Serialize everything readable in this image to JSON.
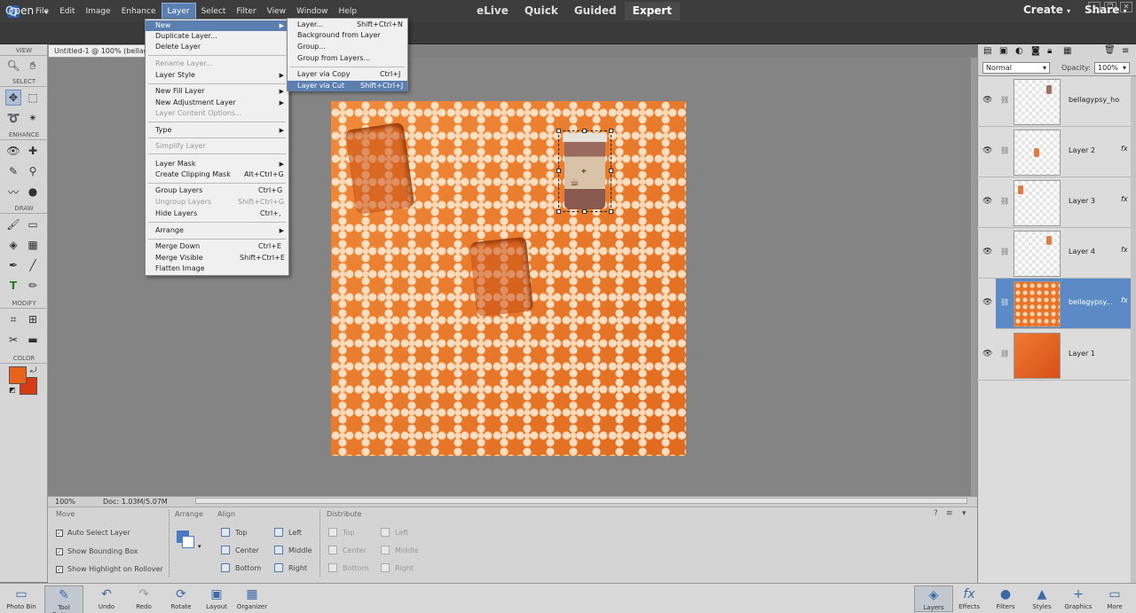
{
  "menubar": {
    "items": [
      "File",
      "Edit",
      "Image",
      "Enhance",
      "Layer",
      "Select",
      "Filter",
      "View",
      "Window",
      "Help"
    ],
    "active": "Layer"
  },
  "modebar": {
    "open_label": "Open",
    "modes": [
      "eLive",
      "Quick",
      "Guided",
      "Expert"
    ],
    "selected_mode": "Expert",
    "create_label": "Create",
    "share_label": "Share"
  },
  "document": {
    "tab_title": "Untitled-1 @ 100% (bellag",
    "zoom": "100%",
    "doc_size": "Doc: 1.03M/5.07M"
  },
  "toolbox": {
    "sections": [
      "VIEW",
      "SELECT",
      "ENHANCE",
      "DRAW",
      "MODIFY",
      "COLOR"
    ],
    "foreground_color": "#e8621a",
    "background_color": "#d83a14"
  },
  "layer_menu": {
    "items": [
      {
        "label": "New",
        "shortcut": "",
        "submenu": true,
        "highlighted": true
      },
      {
        "label": "Duplicate Layer...",
        "shortcut": ""
      },
      {
        "label": "Delete Layer",
        "shortcut": ""
      },
      {
        "label": "Rename Layer...",
        "shortcut": "",
        "disabled": true
      },
      {
        "label": "Layer Style",
        "shortcut": "",
        "submenu": true
      },
      {
        "label": "New Fill Layer",
        "shortcut": "",
        "submenu": true
      },
      {
        "label": "New Adjustment Layer",
        "shortcut": "",
        "submenu": true
      },
      {
        "label": "Layer Content Options...",
        "shortcut": "",
        "disabled": true
      },
      {
        "label": "Type",
        "shortcut": "",
        "submenu": true
      },
      {
        "label": "Simplify Layer",
        "shortcut": "",
        "disabled": true
      },
      {
        "label": "Layer Mask",
        "shortcut": "",
        "submenu": true
      },
      {
        "label": "Create Clipping Mask",
        "shortcut": "Alt+Ctrl+G"
      },
      {
        "label": "Group Layers",
        "shortcut": "Ctrl+G"
      },
      {
        "label": "Ungroup Layers",
        "shortcut": "Shift+Ctrl+G",
        "disabled": true
      },
      {
        "label": "Hide Layers",
        "shortcut": "Ctrl+,"
      },
      {
        "label": "Arrange",
        "shortcut": "",
        "submenu": true
      },
      {
        "label": "Merge Down",
        "shortcut": "Ctrl+E"
      },
      {
        "label": "Merge Visible",
        "shortcut": "Shift+Ctrl+E"
      },
      {
        "label": "Flatten Image",
        "shortcut": ""
      }
    ]
  },
  "new_submenu": {
    "items": [
      {
        "label": "Layer...",
        "shortcut": "Shift+Ctrl+N"
      },
      {
        "label": "Background from Layer",
        "shortcut": ""
      },
      {
        "label": "Group...",
        "shortcut": ""
      },
      {
        "label": "Group from Layers...",
        "shortcut": ""
      },
      {
        "label": "Layer via Copy",
        "shortcut": "Ctrl+J"
      },
      {
        "label": "Layer via Cut",
        "shortcut": "Shift+Ctrl+J",
        "highlighted": true
      }
    ]
  },
  "tool_options": {
    "move_label": "Move",
    "checkboxes": [
      {
        "label": "Auto Select Layer",
        "checked": true
      },
      {
        "label": "Show Bounding Box",
        "checked": true
      },
      {
        "label": "Show Highlight on Rollover",
        "checked": true
      }
    ],
    "arrange_label": "Arrange",
    "align_label": "Align",
    "align_buttons": [
      "Top",
      "Center",
      "Bottom",
      "Left",
      "Middle",
      "Right"
    ],
    "distribute_label": "Distribute",
    "distribute_buttons": [
      "Top",
      "Center",
      "Bottom",
      "Left",
      "Middle",
      "Right"
    ]
  },
  "taskbar": {
    "left": [
      "Photo Bin",
      "Tool Options",
      "Undo",
      "Redo",
      "Rotate",
      "Layout",
      "Organizer"
    ],
    "right": [
      "Layers",
      "Effects",
      "Filters",
      "Styles",
      "Graphics",
      "More"
    ]
  },
  "layers_panel": {
    "blend_mode": "Normal",
    "opacity_label": "Opacity:",
    "opacity_value": "100%",
    "layers": [
      {
        "name": "bellagypsy_ho...",
        "fx": false,
        "selected": false
      },
      {
        "name": "Layer 2",
        "fx": true,
        "selected": false
      },
      {
        "name": "Layer 3",
        "fx": true,
        "selected": false
      },
      {
        "name": "Layer 4",
        "fx": true,
        "selected": false
      },
      {
        "name": "bellagypsy...",
        "fx": true,
        "selected": true
      },
      {
        "name": "Layer 1",
        "fx": false,
        "selected": false
      }
    ]
  }
}
